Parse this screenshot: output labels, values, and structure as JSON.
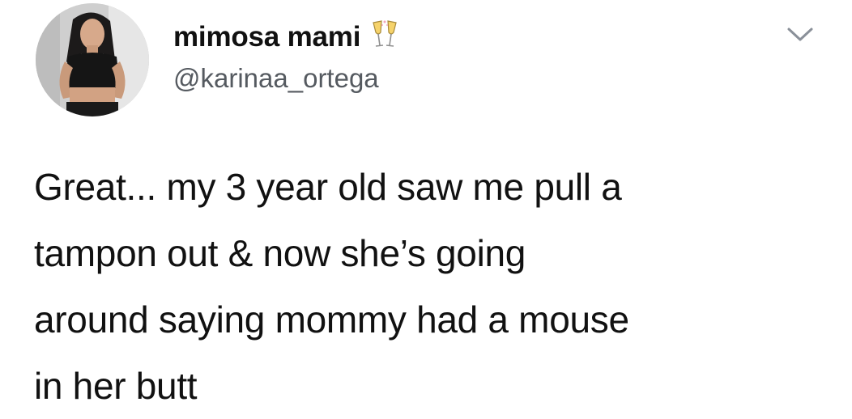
{
  "tweet": {
    "author": {
      "display_name": "mimosa mami",
      "emoji": "🥂",
      "handle": "@karinaa_ortega"
    },
    "text_lines": [
      "Great... my 3 year old saw me pull a",
      "tampon out & now she’s going",
      "around saying mommy had a mouse",
      "in her butt"
    ],
    "menu_icon": "chevron-down-icon",
    "emoji_icon": "clinking-glasses-icon",
    "avatar": "profile-photo"
  }
}
